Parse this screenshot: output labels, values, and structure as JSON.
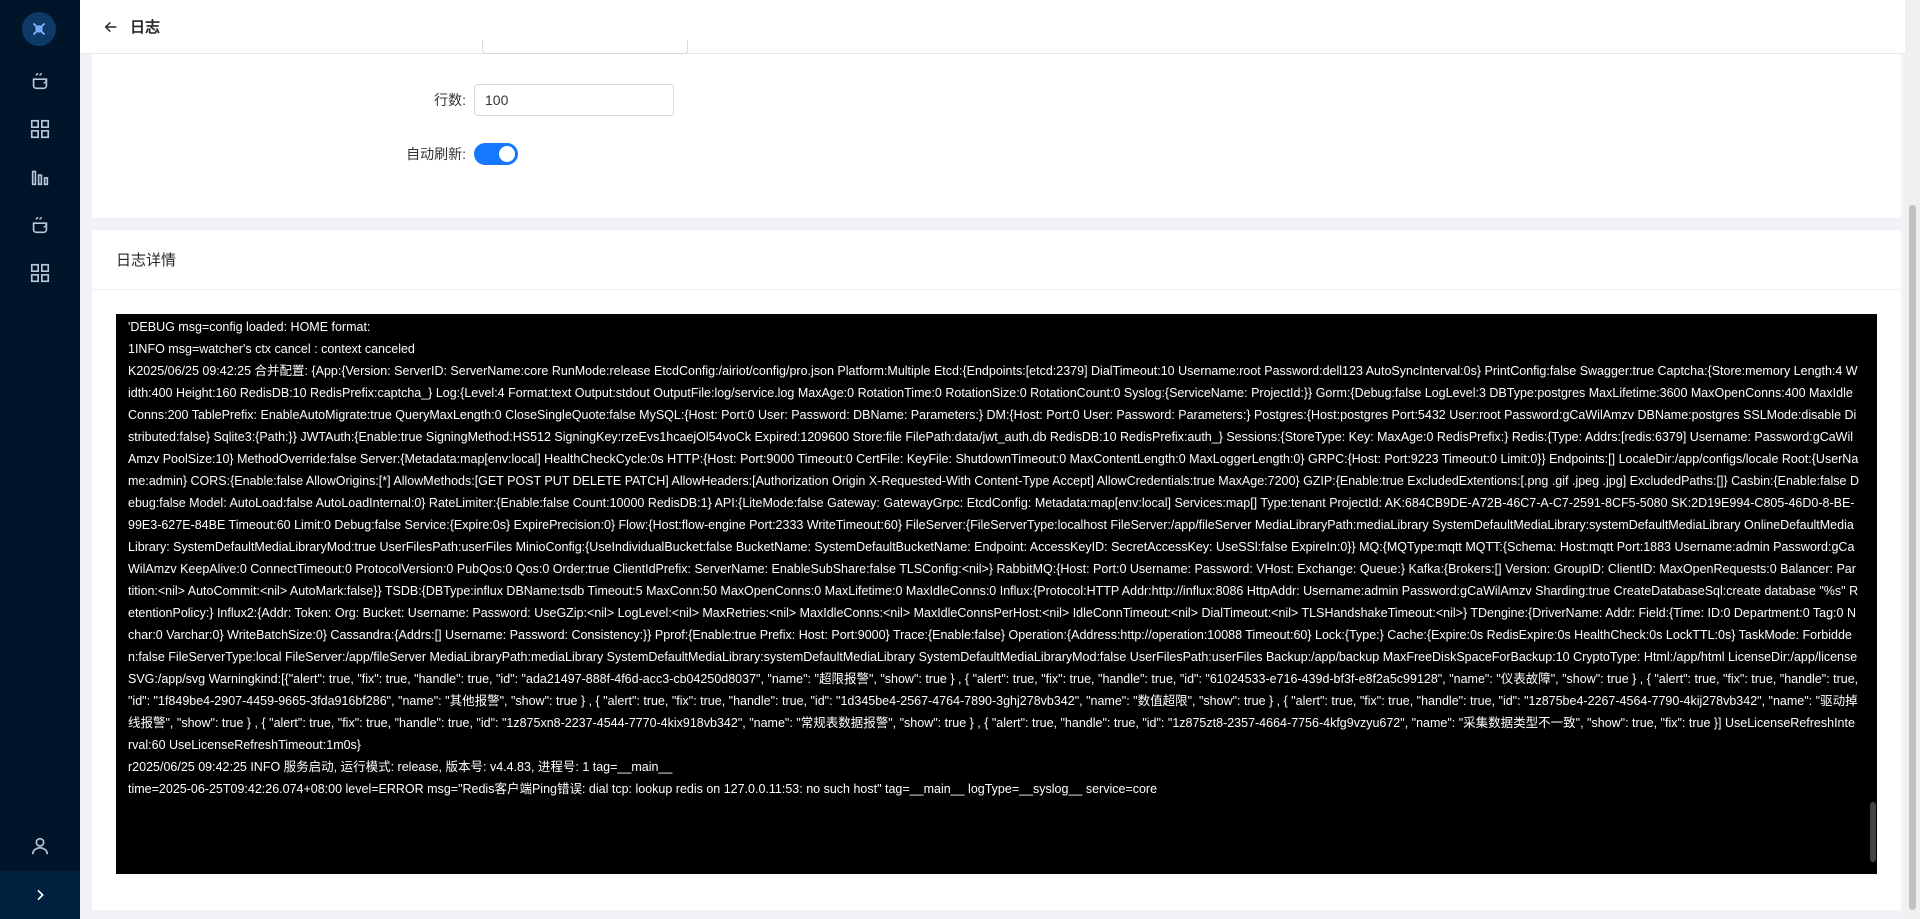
{
  "header": {
    "title": "日志"
  },
  "settings": {
    "rows_label": "行数:",
    "rows_value": "100",
    "auto_refresh_label": "自动刷新:",
    "auto_refresh_on": true
  },
  "log": {
    "title": "日志详情",
    "lines": [
      "'DEBUG msg=config loaded: HOME format:",
      "1INFO msg=watcher's ctx cancel : context canceled",
      "K2025/06/25 09:42:25 合并配置: {App:{Version: ServerID: ServerName:core RunMode:release EtcdConfig:/airiot/config/pro.json Platform:Multiple Etcd:{Endpoints:[etcd:2379] DialTimeout:10 Username:root Password:dell123 AutoSyncInterval:0s} PrintConfig:false Swagger:true Captcha:{Store:memory Length:4 Width:400 Height:160 RedisDB:10 RedisPrefix:captcha_} Log:{Level:4 Format:text Output:stdout OutputFile:log/service.log MaxAge:0 RotationTime:0 RotationSize:0 RotationCount:0 Syslog:{ServiceName: ProjectId:}} Gorm:{Debug:false LogLevel:3 DBType:postgres MaxLifetime:3600 MaxOpenConns:400 MaxIdleConns:200 TablePrefix: EnableAutoMigrate:true QueryMaxLength:0 CloseSingleQuote:false MySQL:{Host: Port:0 User: Password: DBName: Parameters:} DM:{Host: Port:0 User: Password: Parameters:} Postgres:{Host:postgres Port:5432 User:root Password:gCaWilAmzv DBName:postgres SSLMode:disable Distributed:false} Sqlite3:{Path:}} JWTAuth:{Enable:true SigningMethod:HS512 SigningKey:rzeEvs1hcaejOl54voCk Expired:1209600 Store:file FilePath:data/jwt_auth.db RedisDB:10 RedisPrefix:auth_} Sessions:{StoreType: Key: MaxAge:0 RedisPrefix:} Redis:{Type: Addrs:[redis:6379] Username: Password:gCaWilAmzv PoolSize:10} MethodOverride:false Server:{Metadata:map[env:local] HealthCheckCycle:0s HTTP:{Host: Port:9000 Timeout:0 CertFile: KeyFile: ShutdownTimeout:0 MaxContentLength:0 MaxLoggerLength:0} GRPC:{Host: Port:9223 Timeout:0 Limit:0}} Endpoints:[] LocaleDir:/app/configs/locale Root:{UserName:admin} CORS:{Enable:false AllowOrigins:[*] AllowMethods:[GET POST PUT DELETE PATCH] AllowHeaders:[Authorization Origin X-Requested-With Content-Type Accept] AllowCredentials:true MaxAge:7200} GZIP:{Enable:true ExcludedExtentions:[.png .gif .jpeg .jpg] ExcludedPaths:[]} Casbin:{Enable:false Debug:false Model: AutoLoad:false AutoLoadInternal:0} RateLimiter:{Enable:false Count:10000 RedisDB:1} API:{LiteMode:false Gateway: GatewayGrpc: EtcdConfig: Metadata:map[env:local] Services:map[] Type:tenant ProjectId: AK:684CB9DE-A72B-46C7-A-C7-2591-8CF5-5080 SK:2D19E994-C805-46D0-8-BE-99E3-627E-84BE Timeout:60 Limit:0 Debug:false Service:{Expire:0s} ExpirePrecision:0} Flow:{Host:flow-engine Port:2333 WriteTimeout:60} FileServer:{FileServerType:localhost FileServer:/app/fileServer MediaLibraryPath:mediaLibrary SystemDefaultMediaLibrary:systemDefaultMediaLibrary OnlineDefaultMediaLibrary: SystemDefaultMediaLibraryMod:true UserFilesPath:userFiles MinioConfig:{UseIndividualBucket:false BucketName: SystemDefaultBucketName: Endpoint: AccessKeyID: SecretAccessKey: UseSSl:false ExpireIn:0}} MQ:{MQType:mqtt MQTT:{Schema: Host:mqtt Port:1883 Username:admin Password:gCaWilAmzv KeepAlive:0 ConnectTimeout:0 ProtocolVersion:0 PubQos:0 Qos:0 Order:true ClientIdPrefix: ServerName: EnableSubShare:false TLSConfig:<nil>} RabbitMQ:{Host: Port:0 Username: Password: VHost: Exchange: Queue:} Kafka:{Brokers:[] Version: GroupID: ClientID: MaxOpenRequests:0 Balancer: Partition:<nil> AutoCommit:<nil> AutoMark:false}} TSDB:{DBType:influx DBName:tsdb Timeout:5 MaxConn:50 MaxOpenConns:0 MaxLifetime:0 MaxIdleConns:0 Influx:{Protocol:HTTP Addr:http://influx:8086 HttpAddr: Username:admin Password:gCaWilAmzv Sharding:true CreateDatabaseSql:create database \"%s\" RetentionPolicy:} Influx2:{Addr: Token: Org: Bucket: Username: Password: UseGZip:<nil> LogLevel:<nil> MaxRetries:<nil> MaxIdleConns:<nil> MaxIdleConnsPerHost:<nil> IdleConnTimeout:<nil> DialTimeout:<nil> TLSHandshakeTimeout:<nil>} TDengine:{DriverName: Addr: Field:{Time: ID:0 Department:0 Tag:0 Nchar:0 Varchar:0} WriteBatchSize:0} Cassandra:{Addrs:[] Username: Password: Consistency:}} Pprof:{Enable:true Prefix: Host: Port:9000} Trace:{Enable:false} Operation:{Address:http://operation:10088 Timeout:60} Lock:{Type:} Cache:{Expire:0s RedisExpire:0s HealthCheck:0s LockTTL:0s} TaskMode: Forbidden:false FileServerType:local FileServer:/app/fileServer MediaLibraryPath:mediaLibrary SystemDefaultMediaLibrary:systemDefaultMediaLibrary SystemDefaultMediaLibraryMod:false UserFilesPath:userFiles Backup:/app/backup MaxFreeDiskSpaceForBackup:10 CryptoType: Html:/app/html LicenseDir:/app/license SVG:/app/svg Warningkind:[{\"alert\": true, \"fix\": true, \"handle\": true, \"id\": \"ada21497-888f-4f6d-acc3-cb04250d8037\", \"name\": \"超限报警\", \"show\": true } , { \"alert\": true, \"fix\": true, \"handle\": true, \"id\": \"61024533-e716-439d-bf3f-e8f2a5c99128\", \"name\": \"仪表故障\", \"show\": true } , { \"alert\": true, \"fix\": true, \"handle\": true, \"id\": \"1f849be4-2907-4459-9665-3fda916bf286\", \"name\": \"其他报警\", \"show\": true } , { \"alert\": true, \"fix\": true, \"handle\": true, \"id\": \"1d345be4-2567-4764-7890-3ghj278vb342\", \"name\": \"数值超限\", \"show\": true } , { \"alert\": true, \"fix\": true, \"handle\": true, \"id\": \"1z875be4-2267-4564-7790-4kij278vb342\", \"name\": \"驱动掉线报警\", \"show\": true } , { \"alert\": true, \"fix\": true, \"handle\": true, \"id\": \"1z875xn8-2237-4544-7770-4kix918vb342\", \"name\": \"常规表数据报警\", \"show\": true } , { \"alert\": true, \"handle\": true, \"id\": \"1z875zt8-2357-4664-7756-4kfg9vzyu672\", \"name\": \"采集数据类型不一致\", \"show\": true, \"fix\": true }] UseLicenseRefreshInterval:60 UseLicenseRefreshTimeout:1m0s}",
      "r2025/06/25 09:42:25 INFO 服务启动, 运行模式: release, 版本号: v4.4.83, 进程号: 1 tag=__main__",
      "time=2025-06-25T09:42:26.074+08:00 level=ERROR msg=\"Redis客户端Ping错误: dial tcp: lookup redis on 127.0.0.11:53: no such host\" tag=__main__ logType=__syslog__ service=core"
    ]
  },
  "icons": {
    "logo": "tools-logo-icon",
    "menu": [
      "cloud-server-icon",
      "apps-grid-icon",
      "bar-chart-icon",
      "cloud-server-icon",
      "apps-grid-icon"
    ],
    "user": "user-icon",
    "expand": "chevron-right-icon"
  },
  "colors": {
    "sidebar": "#001529",
    "accent": "#1677ff",
    "log_bg": "#000000"
  }
}
